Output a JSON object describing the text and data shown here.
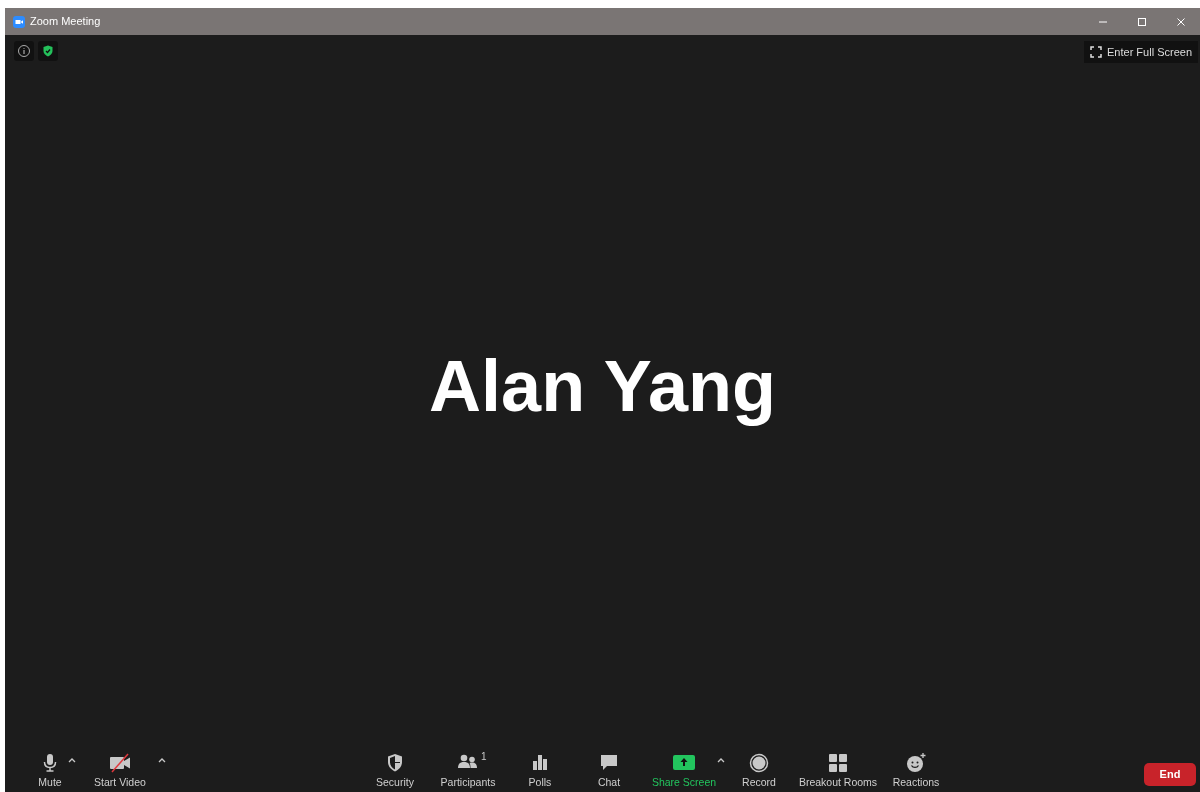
{
  "window": {
    "title": "Zoom Meeting"
  },
  "top_left": [
    {
      "kind": "info"
    },
    {
      "kind": "shield"
    }
  ],
  "full_screen": {
    "label": "Enter Full Screen"
  },
  "participant": {
    "name": "Alan Yang"
  },
  "toolbar": {
    "left": [
      {
        "kind": "mic",
        "label": "Mute",
        "caret": true,
        "highlighted": false
      },
      {
        "kind": "video_off",
        "label": "Start Video",
        "caret": true,
        "highlighted": false
      }
    ],
    "center": [
      {
        "kind": "security",
        "label": "Security",
        "caret": false,
        "highlighted": false
      },
      {
        "kind": "participants",
        "label": "Participants",
        "badge": "1",
        "caret": false,
        "highlighted": false
      },
      {
        "kind": "polls",
        "label": "Polls",
        "caret": false,
        "highlighted": false
      },
      {
        "kind": "chat",
        "label": "Chat",
        "caret": false,
        "highlighted": false
      },
      {
        "kind": "share",
        "label": "Share Screen",
        "caret": true,
        "highlighted": true
      },
      {
        "kind": "record",
        "label": "Record",
        "caret": false,
        "highlighted": false
      },
      {
        "kind": "breakout",
        "label": "Breakout Rooms",
        "caret": false,
        "highlighted": false
      },
      {
        "kind": "reactions",
        "label": "Reactions",
        "caret": false,
        "highlighted": false
      }
    ],
    "end": {
      "label": "End"
    }
  }
}
